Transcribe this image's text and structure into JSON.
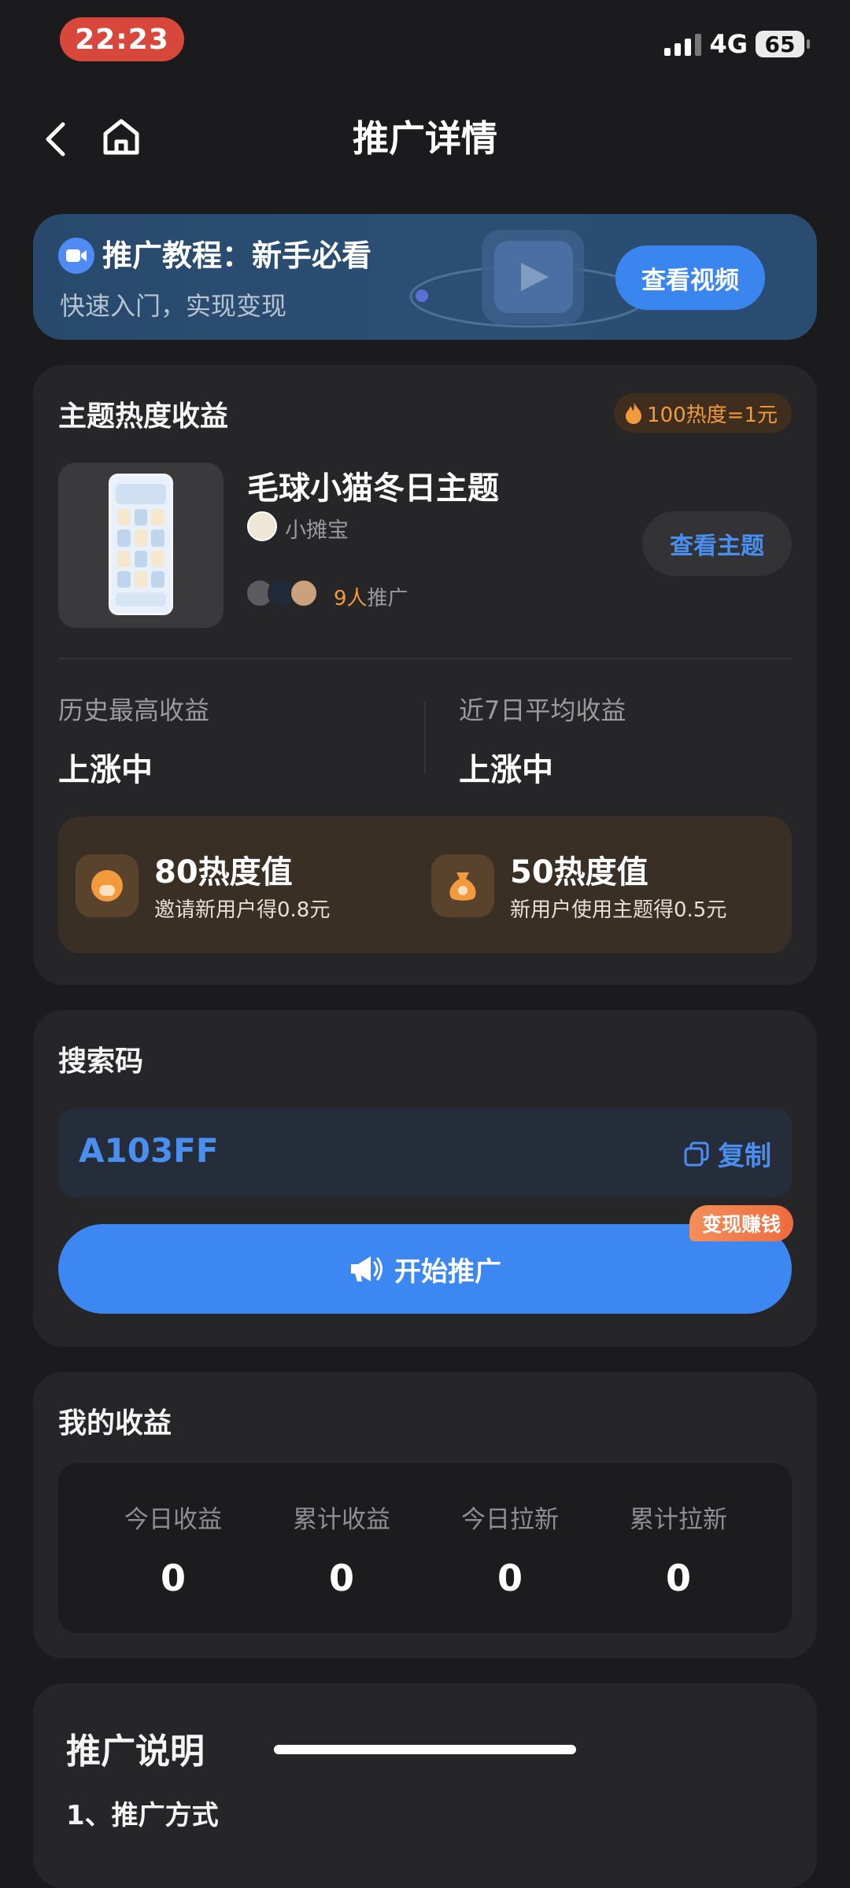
{
  "status_bar": {
    "time": "22:23",
    "network": "4G",
    "battery": "65"
  },
  "nav": {
    "title": "推广详情"
  },
  "banner": {
    "title": "推广教程：新手必看",
    "subtitle": "快速入门，实现变现",
    "button": "查看视频"
  },
  "theme_card": {
    "title": "主题热度收益",
    "heat_badge": "100热度=1元",
    "theme_name": "毛球小猫冬日主题",
    "author": "小摊宝",
    "promoter_count": "9人",
    "promoter_suffix": "推广",
    "view_button": "查看主题",
    "stats": [
      {
        "label": "历史最高收益",
        "value": "上涨中"
      },
      {
        "label": "近7日平均收益",
        "value": "上涨中"
      }
    ],
    "rewards": [
      {
        "title": "80热度值",
        "desc": "邀请新用户得0.8元"
      },
      {
        "title": "50热度值",
        "desc": "新用户使用主题得0.5元"
      }
    ]
  },
  "search_code": {
    "title": "搜索码",
    "code": "A103FF",
    "copy_label": "复制",
    "start_button": "开始推广",
    "earn_tag": "变现赚钱"
  },
  "earnings": {
    "title": "我的收益",
    "items": [
      {
        "label": "今日收益",
        "value": "0"
      },
      {
        "label": "累计收益",
        "value": "0"
      },
      {
        "label": "今日拉新",
        "value": "0"
      },
      {
        "label": "累计拉新",
        "value": "0"
      }
    ]
  },
  "instructions": {
    "title": "推广说明",
    "item1": "1、推广方式"
  },
  "colors": {
    "accent": "#3c87f1",
    "orange": "#f39a3c",
    "background": "#1b1b1d",
    "card": "#262628"
  }
}
